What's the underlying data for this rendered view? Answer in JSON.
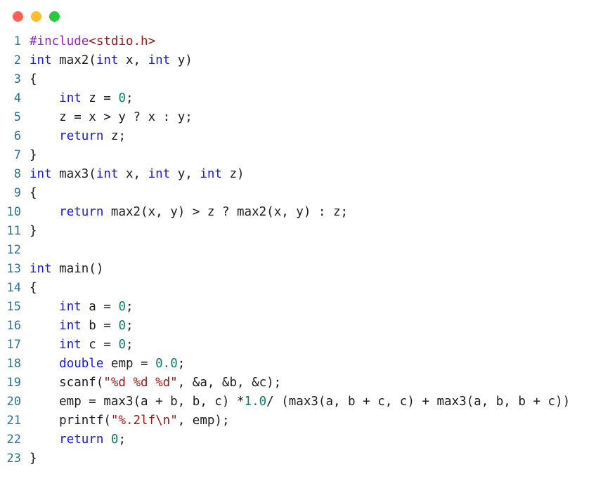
{
  "window": {
    "title": "",
    "background_color": "#ffffff",
    "traffic_lights": [
      {
        "name": "close",
        "label": "",
        "color": "#ff5f56"
      },
      {
        "name": "minimize",
        "label": "",
        "color": "#ffbd2e"
      },
      {
        "name": "maximize",
        "label": "",
        "color": "#27c93f"
      }
    ]
  },
  "editor": {
    "language": "c",
    "gutter_color": "#2a7296",
    "text_color": "#1c1c1c",
    "token_colors": {
      "keyword": "#1414ff",
      "preprocessor": "#9b1fd1",
      "string": "#a31515",
      "number": "#0d8068",
      "plain": "#1c1c1c"
    },
    "first_line_number": 1,
    "last_line_number": 23,
    "total_lines": 23,
    "lines": [
      {
        "n": "1",
        "plain": "#include<stdio.h>",
        "tokens": [
          {
            "t": "#include",
            "c": "pre"
          },
          {
            "t": "<stdio.h>",
            "c": "str"
          }
        ]
      },
      {
        "n": "2",
        "plain": "int max2(int x, int y)",
        "tokens": [
          {
            "t": "int",
            "c": "kw"
          },
          {
            "t": " max2(",
            "c": "plain"
          },
          {
            "t": "int",
            "c": "kw"
          },
          {
            "t": " x, ",
            "c": "plain"
          },
          {
            "t": "int",
            "c": "kw"
          },
          {
            "t": " y)",
            "c": "plain"
          }
        ]
      },
      {
        "n": "3",
        "plain": "{",
        "tokens": [
          {
            "t": "{",
            "c": "plain"
          }
        ]
      },
      {
        "n": "4",
        "plain": "    int z = 0;",
        "tokens": [
          {
            "t": "    ",
            "c": "plain"
          },
          {
            "t": "int",
            "c": "kw"
          },
          {
            "t": " z = ",
            "c": "plain"
          },
          {
            "t": "0",
            "c": "num"
          },
          {
            "t": ";",
            "c": "plain"
          }
        ]
      },
      {
        "n": "5",
        "plain": "    z = x > y ? x : y;",
        "tokens": [
          {
            "t": "    z = x > y ? x : y;",
            "c": "plain"
          }
        ]
      },
      {
        "n": "6",
        "plain": "    return z;",
        "tokens": [
          {
            "t": "    ",
            "c": "plain"
          },
          {
            "t": "return",
            "c": "kw"
          },
          {
            "t": " z;",
            "c": "plain"
          }
        ]
      },
      {
        "n": "7",
        "plain": "}",
        "tokens": [
          {
            "t": "}",
            "c": "plain"
          }
        ]
      },
      {
        "n": "8",
        "plain": "int max3(int x, int y, int z)",
        "tokens": [
          {
            "t": "int",
            "c": "kw"
          },
          {
            "t": " max3(",
            "c": "plain"
          },
          {
            "t": "int",
            "c": "kw"
          },
          {
            "t": " x, ",
            "c": "plain"
          },
          {
            "t": "int",
            "c": "kw"
          },
          {
            "t": " y, ",
            "c": "plain"
          },
          {
            "t": "int",
            "c": "kw"
          },
          {
            "t": " z)",
            "c": "plain"
          }
        ]
      },
      {
        "n": "9",
        "plain": "{",
        "tokens": [
          {
            "t": "{",
            "c": "plain"
          }
        ]
      },
      {
        "n": "10",
        "plain": "    return max2(x, y) > z ? max2(x, y) : z;",
        "tokens": [
          {
            "t": "    ",
            "c": "plain"
          },
          {
            "t": "return",
            "c": "kw"
          },
          {
            "t": " max2(x, y) > z ? max2(x, y) : z;",
            "c": "plain"
          }
        ]
      },
      {
        "n": "11",
        "plain": "}",
        "tokens": [
          {
            "t": "}",
            "c": "plain"
          }
        ]
      },
      {
        "n": "12",
        "plain": "",
        "tokens": []
      },
      {
        "n": "13",
        "plain": "int main()",
        "tokens": [
          {
            "t": "int",
            "c": "kw"
          },
          {
            "t": " main()",
            "c": "plain"
          }
        ]
      },
      {
        "n": "14",
        "plain": "{",
        "tokens": [
          {
            "t": "{",
            "c": "plain"
          }
        ]
      },
      {
        "n": "15",
        "plain": "    int a = 0;",
        "tokens": [
          {
            "t": "    ",
            "c": "plain"
          },
          {
            "t": "int",
            "c": "kw"
          },
          {
            "t": " a = ",
            "c": "plain"
          },
          {
            "t": "0",
            "c": "num"
          },
          {
            "t": ";",
            "c": "plain"
          }
        ]
      },
      {
        "n": "16",
        "plain": "    int b = 0;",
        "tokens": [
          {
            "t": "    ",
            "c": "plain"
          },
          {
            "t": "int",
            "c": "kw"
          },
          {
            "t": " b = ",
            "c": "plain"
          },
          {
            "t": "0",
            "c": "num"
          },
          {
            "t": ";",
            "c": "plain"
          }
        ]
      },
      {
        "n": "17",
        "plain": "    int c = 0;",
        "tokens": [
          {
            "t": "    ",
            "c": "plain"
          },
          {
            "t": "int",
            "c": "kw"
          },
          {
            "t": " c = ",
            "c": "plain"
          },
          {
            "t": "0",
            "c": "num"
          },
          {
            "t": ";",
            "c": "plain"
          }
        ]
      },
      {
        "n": "18",
        "plain": "    double emp = 0.0;",
        "tokens": [
          {
            "t": "    ",
            "c": "plain"
          },
          {
            "t": "double",
            "c": "kw"
          },
          {
            "t": " emp = ",
            "c": "plain"
          },
          {
            "t": "0.0",
            "c": "num"
          },
          {
            "t": ";",
            "c": "plain"
          }
        ]
      },
      {
        "n": "19",
        "plain": "    scanf(\"%d %d %d\", &a, &b, &c);",
        "tokens": [
          {
            "t": "    scanf(",
            "c": "plain"
          },
          {
            "t": "\"%d %d %d\"",
            "c": "str"
          },
          {
            "t": ", &a, &b, &c);",
            "c": "plain"
          }
        ]
      },
      {
        "n": "20",
        "plain": "    emp = max3(a + b, b, c) *1.0/ (max3(a, b + c, c) + max3(a, b, b + c))",
        "tokens": [
          {
            "t": "    emp = max3(a + b, b, c) *",
            "c": "plain"
          },
          {
            "t": "1.0",
            "c": "num"
          },
          {
            "t": "/ (max3(a, b + c, c) + max3(a, b, b + c))",
            "c": "plain"
          }
        ]
      },
      {
        "n": "21",
        "plain": "    printf(\"%.2lf\\n\", emp);",
        "tokens": [
          {
            "t": "    printf(",
            "c": "plain"
          },
          {
            "t": "\"%.2lf\\n\"",
            "c": "str"
          },
          {
            "t": ", emp);",
            "c": "plain"
          }
        ]
      },
      {
        "n": "22",
        "plain": "    return 0;",
        "tokens": [
          {
            "t": "    ",
            "c": "plain"
          },
          {
            "t": "return",
            "c": "kw"
          },
          {
            "t": " ",
            "c": "plain"
          },
          {
            "t": "0",
            "c": "num"
          },
          {
            "t": ";",
            "c": "plain"
          }
        ]
      },
      {
        "n": "23",
        "plain": "}",
        "tokens": [
          {
            "t": "}",
            "c": "plain"
          }
        ]
      }
    ]
  }
}
